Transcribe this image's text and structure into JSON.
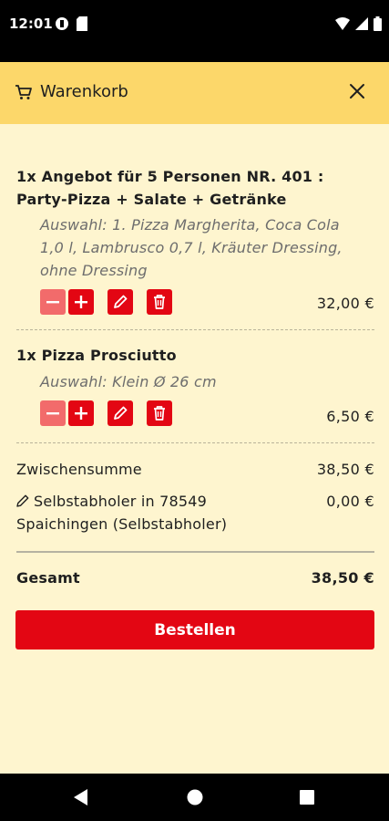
{
  "status_bar": {
    "time": "12:01"
  },
  "header": {
    "title": "Warenkorb"
  },
  "items": [
    {
      "title": "1x Angebot für 5 Personen NR. 401 : Party-Pizza + Salate + Getränke",
      "selection": "Auswahl: 1. Pizza Margherita, Coca Cola 1,0 l, Lambrusco 0,7 l, Kräuter Dressing, ohne Dressing",
      "price": "32,00 €"
    },
    {
      "title": "1x Pizza Prosciutto",
      "selection": "Auswahl: Klein Ø 26 cm",
      "price": "6,50 €"
    }
  ],
  "summary": {
    "subtotal_label": "Zwischensumme",
    "subtotal_value": "38,50 €",
    "pickup_label": "Selbstabholer in 78549 Spaichingen (Selbstabholer)",
    "pickup_value": "0,00 €",
    "total_label": "Gesamt",
    "total_value": "38,50 €"
  },
  "order_button": "Bestellen",
  "colors": {
    "accent": "#e30613",
    "header": "#fcd76a",
    "background": "#fef5cf"
  }
}
